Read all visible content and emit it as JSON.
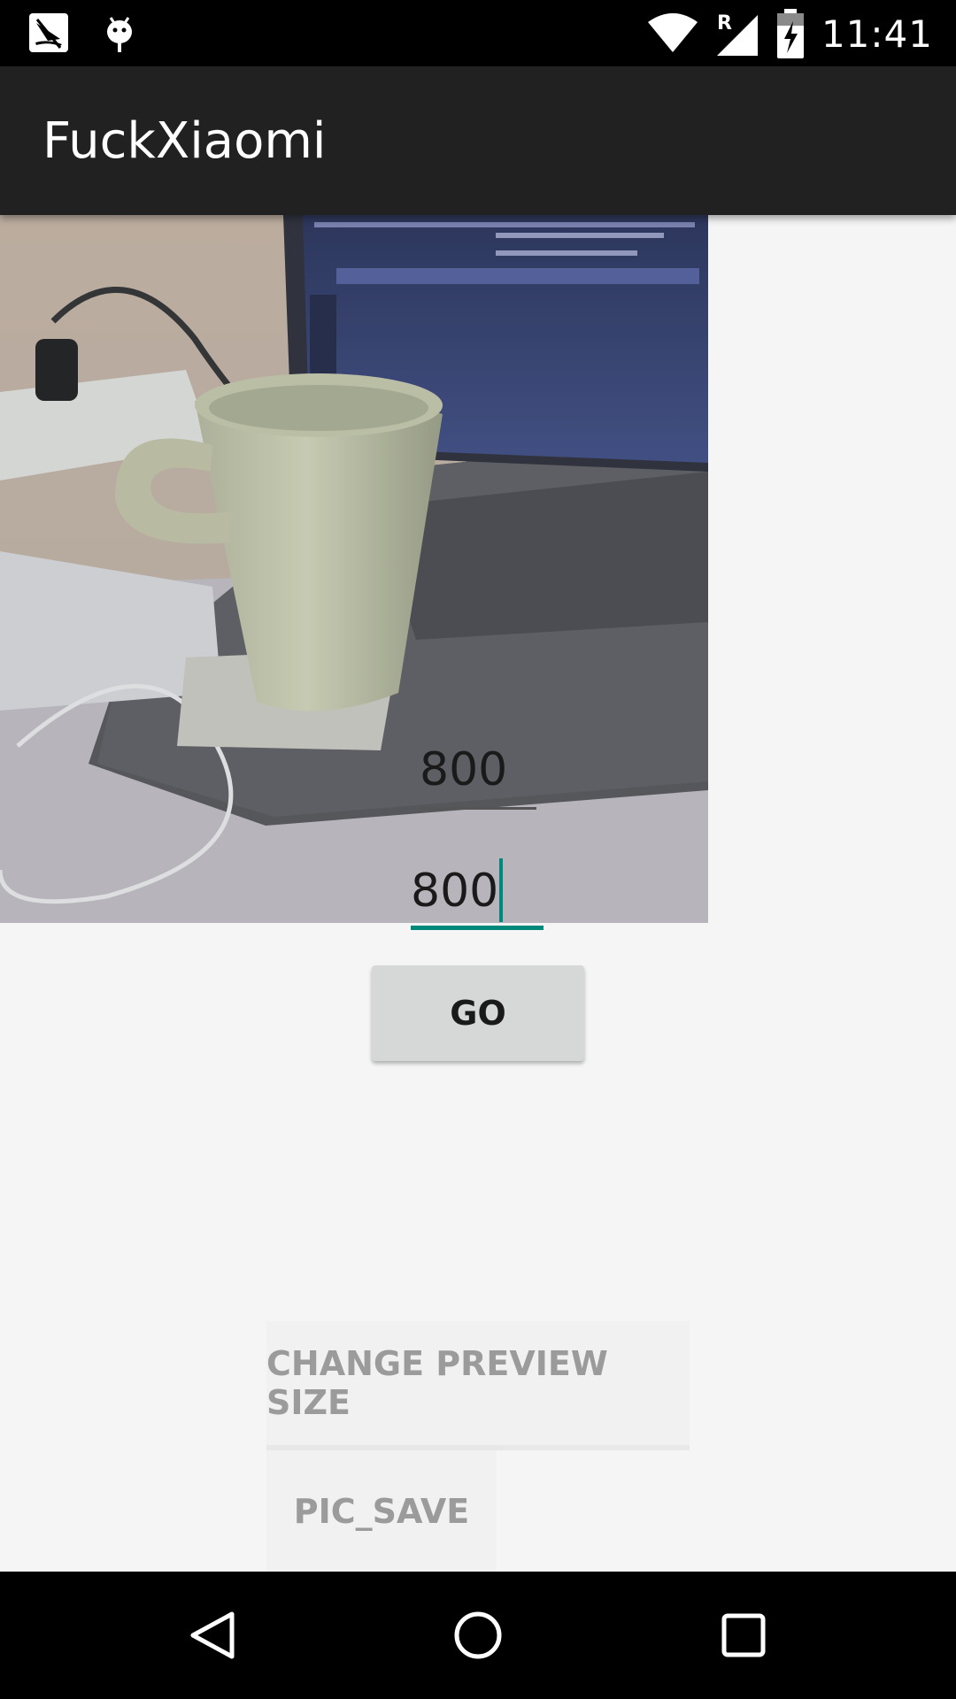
{
  "status_bar": {
    "time": "11:41",
    "notification_icons": [
      "sailboat-notification-icon",
      "android-debug-icon"
    ],
    "system_icons": [
      "wifi-icon",
      "signal-roaming-icon",
      "battery-charging-icon"
    ],
    "roaming_label": "R"
  },
  "app_bar": {
    "title": "FuckXiaomi"
  },
  "preview": {
    "content": "camera-preview"
  },
  "fields": {
    "width_value": "800",
    "height_value": "800"
  },
  "buttons": {
    "go": "GO",
    "change_preview_size": "CHANGE PREVIEW SIZE",
    "pic_save": "PIC_SAVE"
  },
  "nav_bar": {
    "icons": [
      "back-icon",
      "home-icon",
      "recents-icon"
    ]
  },
  "colors": {
    "app_bar": "#212121",
    "accent": "#00897b",
    "background": "#f5f5f5"
  }
}
